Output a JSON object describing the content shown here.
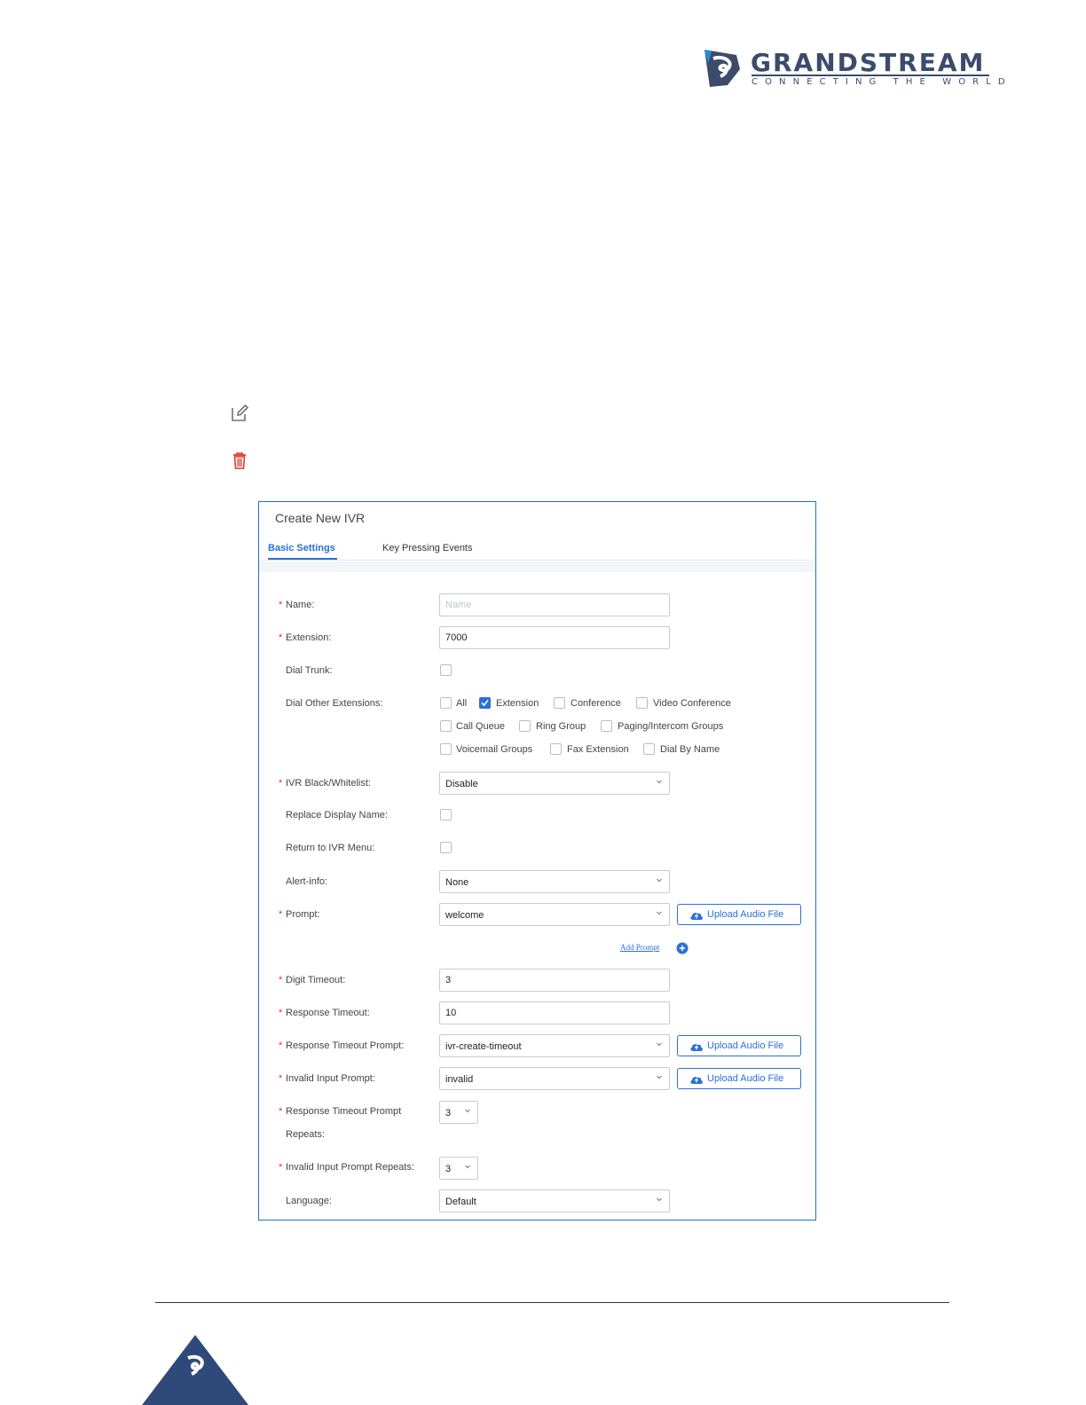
{
  "brand": {
    "name": "GRANDSTREAM",
    "tagline": "CONNECTING THE WORLD",
    "colors": {
      "navy": "#3d4b6b",
      "blue": "#2c6fd6",
      "footer_triangle": "#2f4a7a"
    }
  },
  "icons": {
    "edit": "edit-icon",
    "delete": "trash-icon"
  },
  "dialog": {
    "title": "Create New IVR",
    "tabs": [
      {
        "label": "Basic Settings",
        "active": true
      },
      {
        "label": "Key Pressing Events",
        "active": false
      }
    ],
    "fields": {
      "name": {
        "label": "Name",
        "value": "",
        "placeholder": "Name",
        "required": true
      },
      "extension": {
        "label": "Extension",
        "value": "7000",
        "required": true
      },
      "dial_trunk": {
        "label": "Dial Trunk",
        "checked": false
      },
      "dial_other_extensions": {
        "label": "Dial Other Extensions",
        "options": [
          {
            "label": "All",
            "checked": false
          },
          {
            "label": "Extension",
            "checked": true
          },
          {
            "label": "Conference",
            "checked": false
          },
          {
            "label": "Video Conference",
            "checked": false
          },
          {
            "label": "Call Queue",
            "checked": false
          },
          {
            "label": "Ring Group",
            "checked": false
          },
          {
            "label": "Paging/Intercom Groups",
            "checked": false
          },
          {
            "label": "Voicemail Groups",
            "checked": false
          },
          {
            "label": "Fax Extension",
            "checked": false
          },
          {
            "label": "Dial By Name",
            "checked": false
          }
        ]
      },
      "ivr_blacklist": {
        "label": "IVR Black/Whitelist",
        "value": "Disable",
        "required": true
      },
      "replace_display_name": {
        "label": "Replace Display Name",
        "checked": false
      },
      "return_to_ivr_menu": {
        "label": "Return to IVR Menu",
        "checked": false
      },
      "alert_info": {
        "label": "Alert-info",
        "value": "None"
      },
      "prompt": {
        "label": "Prompt",
        "value": "welcome",
        "required": true
      },
      "add_prompt": "Add Prompt",
      "digit_timeout": {
        "label": "Digit Timeout",
        "value": "3",
        "required": true
      },
      "response_timeout": {
        "label": "Response Timeout",
        "value": "10",
        "required": true
      },
      "response_timeout_prompt": {
        "label": "Response Timeout Prompt",
        "value": "ivr-create-timeout",
        "required": true
      },
      "invalid_input_prompt": {
        "label": "Invalid Input Prompt",
        "value": "invalid",
        "required": true
      },
      "response_timeout_prompt_repeats": {
        "label_line1": "Response Timeout Prompt",
        "label_line2": "Repeats",
        "value": "3",
        "required": true
      },
      "invalid_input_prompt_repeats": {
        "label": "Invalid Input Prompt Repeats",
        "value": "3",
        "required": true
      },
      "language": {
        "label": "Language",
        "value": "Default"
      }
    },
    "upload_label": "Upload Audio File",
    "label_suffix": ":",
    "required_mark": "*"
  }
}
